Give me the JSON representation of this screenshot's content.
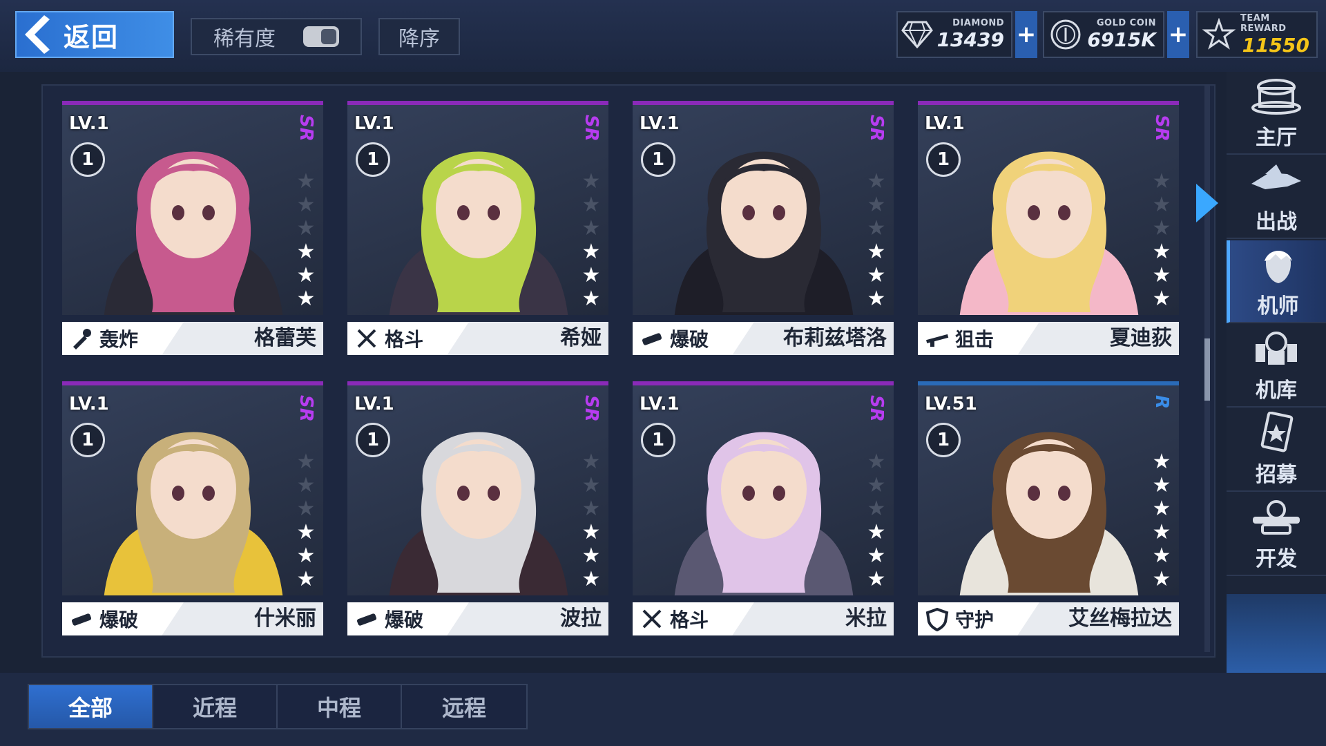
{
  "header": {
    "back_label": "返回",
    "rarity_label": "稀有度",
    "sort_label": "降序"
  },
  "resources": {
    "diamond": {
      "caption": "DIAMOND",
      "value": "13439",
      "icon": "diamond-icon"
    },
    "gold": {
      "caption": "GOLD COIN",
      "value": "6915K",
      "icon": "coin-icon"
    },
    "team": {
      "caption": "TEAM REWARD",
      "value": "11550",
      "icon": "star-emblem-icon"
    },
    "plus_label": "+"
  },
  "cards": [
    {
      "level": "LV.1",
      "badge": "1",
      "rank": "SR",
      "stars": 3,
      "role": "轰炸",
      "role_icon": "bomb-icon",
      "name": "格蕾芙"
    },
    {
      "level": "LV.1",
      "badge": "1",
      "rank": "SR",
      "stars": 3,
      "role": "格斗",
      "role_icon": "crossed-swords-icon",
      "name": "希娅"
    },
    {
      "level": "LV.1",
      "badge": "1",
      "rank": "SR",
      "stars": 3,
      "role": "爆破",
      "role_icon": "launcher-icon",
      "name": "布莉兹塔洛"
    },
    {
      "level": "LV.1",
      "badge": "1",
      "rank": "SR",
      "stars": 3,
      "role": "狙击",
      "role_icon": "rifle-icon",
      "name": "夏迪荻"
    },
    {
      "level": "LV.1",
      "badge": "1",
      "rank": "SR",
      "stars": 3,
      "role": "爆破",
      "role_icon": "launcher-icon",
      "name": "什米丽"
    },
    {
      "level": "LV.1",
      "badge": "1",
      "rank": "SR",
      "stars": 3,
      "role": "爆破",
      "role_icon": "launcher-icon",
      "name": "波拉"
    },
    {
      "level": "LV.1",
      "badge": "1",
      "rank": "SR",
      "stars": 3,
      "role": "格斗",
      "role_icon": "crossed-swords-icon",
      "name": "米拉"
    },
    {
      "level": "LV.51",
      "badge": "1",
      "rank": "R",
      "stars": 6,
      "role": "守护",
      "role_icon": "shield-icon",
      "name": "艾丝梅拉达"
    }
  ],
  "sidebar": {
    "items": [
      {
        "label": "主厅",
        "icon": "hall-icon"
      },
      {
        "label": "出战",
        "icon": "sortie-ship-icon"
      },
      {
        "label": "机师",
        "icon": "pilot-icon"
      },
      {
        "label": "机库",
        "icon": "hangar-mech-icon"
      },
      {
        "label": "招募",
        "icon": "recruit-card-icon"
      },
      {
        "label": "开发",
        "icon": "develop-wrench-icon"
      }
    ],
    "active_index": 2
  },
  "tabs": [
    "全部",
    "近程",
    "中程",
    "远程"
  ],
  "active_tab": 0,
  "colors": {
    "accent_blue": "#3f8ee6",
    "sr_purple": "#b73cf0",
    "r_blue": "#3a8de8",
    "team_reward_gold": "#f5c518"
  }
}
